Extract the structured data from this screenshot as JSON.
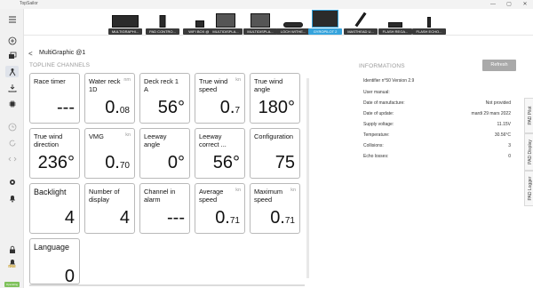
{
  "window": {
    "title": "TopSailor",
    "minimize": "—",
    "maximize": "▢",
    "close": "✕"
  },
  "sidebar": {
    "icons": [
      "menu-icon",
      "add-icon",
      "layers-icon",
      "user-icon",
      "download-icon",
      "chip-icon",
      "clock-icon",
      "sync-icon",
      "code-icon",
      "gear-icon",
      "bell-icon",
      "lock-icon",
      "bell-settings-icon"
    ],
    "logo": "nke",
    "status": "Operating"
  },
  "devices": [
    {
      "label": "MULTIGRAPHI..."
    },
    {
      "label": "PAD CONTRO..."
    },
    {
      "label": "WIFI BOX @3"
    },
    {
      "label": "MULTIDISPLA..."
    },
    {
      "label": "MULTIDISPLA..."
    },
    {
      "label": "LOCH WITHE..."
    },
    {
      "label": "GYROPILOT 2"
    },
    {
      "label": "MASTHEAD U..."
    },
    {
      "label": "FLASH REGA..."
    },
    {
      "label": "FLASH ECHO..."
    }
  ],
  "breadcrumb": {
    "back": "<",
    "title": "MultiGraphic @1"
  },
  "topline": {
    "section_title": "TOPLINE CHANNELS",
    "tiles": [
      {
        "label": "Race timer",
        "unit": "",
        "value": "---",
        "dec": ""
      },
      {
        "label": "Water reck 1D",
        "unit": "nm",
        "value": "0.",
        "dec": "08"
      },
      {
        "label": "Deck reck 1 A",
        "unit": "",
        "value": "56°",
        "dec": ""
      },
      {
        "label": "True wind speed",
        "unit": "kn",
        "value": "0.",
        "dec": "7"
      },
      {
        "label": "True wind angle",
        "unit": "",
        "value": "180°",
        "dec": ""
      },
      {
        "label": "True wind direction",
        "unit": "",
        "value": "236°",
        "dec": ""
      },
      {
        "label": "VMG",
        "unit": "kn",
        "value": "0.",
        "dec": "70"
      },
      {
        "label": "Leeway angle",
        "unit": "",
        "value": "0°",
        "dec": ""
      },
      {
        "label": "Leeway correct ...",
        "unit": "",
        "value": "56°",
        "dec": ""
      },
      {
        "label": "Configuration",
        "unit": "",
        "value": "75",
        "dec": ""
      },
      {
        "label": "Backlight",
        "unit": "",
        "value": "4",
        "dec": ""
      },
      {
        "label": "Number of display",
        "unit": "",
        "value": "4",
        "dec": ""
      },
      {
        "label": "Channel in alarm",
        "unit": "",
        "value": "---",
        "dec": ""
      },
      {
        "label": "Average speed",
        "unit": "kn",
        "value": "0.",
        "dec": "71"
      },
      {
        "label": "Maximum speed",
        "unit": "kn",
        "value": "0.",
        "dec": "71"
      },
      {
        "label": "Language",
        "unit": "",
        "value": "0",
        "dec": ""
      }
    ]
  },
  "info": {
    "section_title": "INFORMATIONS",
    "refresh": "Refresh",
    "identifier": "Identifier n°50 Version 2.9",
    "rows": [
      {
        "k": "User manual:",
        "v": ""
      },
      {
        "k": "Date of manufacture:",
        "v": "Not provided"
      },
      {
        "k": "Date of update:",
        "v": "mardi 29 mars 2022"
      },
      {
        "k": "Supply voltage:",
        "v": "11.15V"
      },
      {
        "k": "Temperature:",
        "v": "30.56°C"
      },
      {
        "k": "Collisions:",
        "v": "3"
      },
      {
        "k": "Echo losses:",
        "v": "0"
      }
    ]
  },
  "right_tabs": [
    "PAD Pilot",
    "PAD Display",
    "PAD Logger"
  ]
}
